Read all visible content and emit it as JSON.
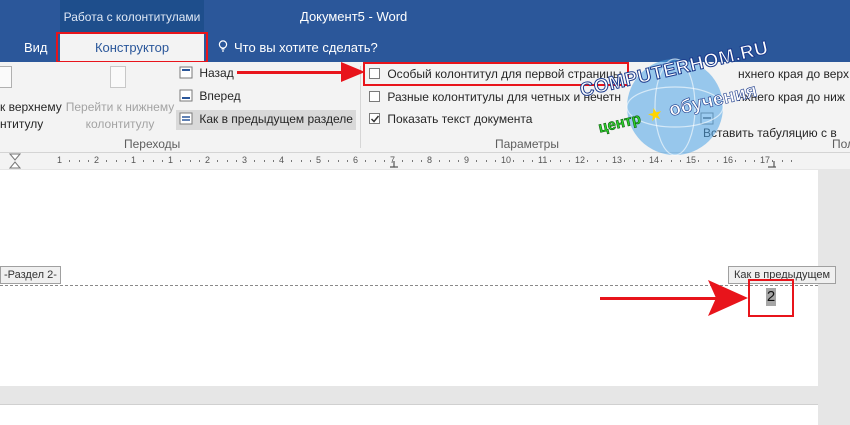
{
  "titlebar": {
    "context_group": "Работа с колонтитулами",
    "document_title": "Документ5 - Word"
  },
  "tabs": {
    "view": "Вид",
    "designer": "Конструктор",
    "tell_me": "Что вы хотите сделать?"
  },
  "ribbon": {
    "navigation": {
      "goto_header_line1": "к верхнему",
      "goto_header_line2": "нтитулу",
      "goto_footer_line1": "Перейти к нижнему",
      "goto_footer_line2": "колонтитулу",
      "back": "Назад",
      "forward": "Вперед",
      "link_previous": "Как в предыдущем разделе",
      "group_label": "Переходы"
    },
    "options": {
      "different_first_page": "Особый колонтитул для первой страницы",
      "different_odd_even": "Разные колонтитулы для четных и нечетн",
      "show_document_text": "Показать текст документа",
      "group_label": "Параметры"
    },
    "position": {
      "header_from_top": "нхнего края до верх",
      "footer_from_bottom": "нхнего края до ниж",
      "insert_alignment_tab": "Вставить табуляцию с в",
      "group_label": "Пол"
    }
  },
  "ruler": {
    "labels": [
      "1",
      "2",
      "1",
      "1",
      "2",
      "3",
      "4",
      "5",
      "6",
      "7",
      "8",
      "9",
      "10",
      "11",
      "12",
      "13",
      "14",
      "15",
      "16",
      "17"
    ]
  },
  "document": {
    "section_tag": "-Раздел 2-",
    "link_previous_tag": "Как в предыдущем",
    "page_number": "2"
  },
  "watermark": {
    "line1": "COMPUTERHOM.RU",
    "line2_left": "центр",
    "line2_right": "обучения"
  },
  "colors": {
    "word_blue": "#2b579a",
    "highlight_red": "#e8141b",
    "watermark_green": "#2bd22b"
  }
}
